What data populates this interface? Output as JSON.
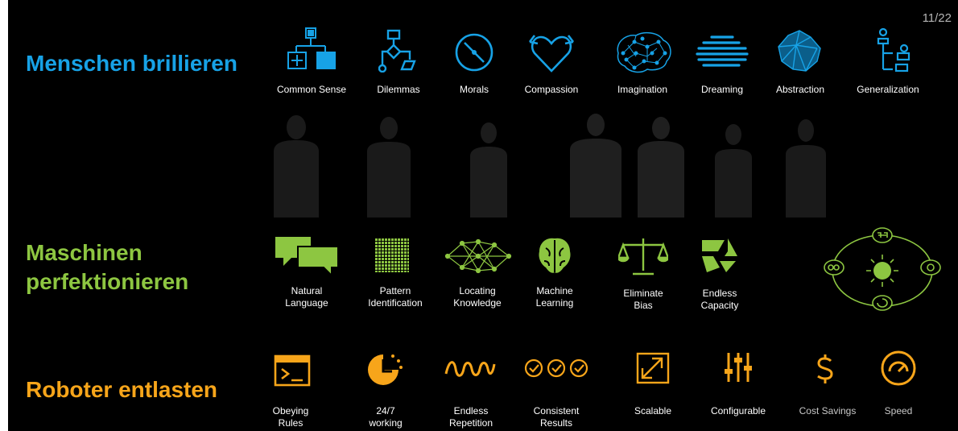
{
  "page_number": "11/22",
  "sections": {
    "humans": {
      "title": "Menschen brillieren",
      "color": "#17a2e6",
      "items": [
        {
          "label": "Common Sense",
          "icon": "decision-tree-icon"
        },
        {
          "label": "Dilemmas",
          "icon": "flowchart-icon"
        },
        {
          "label": "Morals",
          "icon": "compass-needle-icon"
        },
        {
          "label": "Compassion",
          "icon": "heart-arrows-icon"
        },
        {
          "label": "Imagination",
          "icon": "brain-network-icon"
        },
        {
          "label": "Dreaming",
          "icon": "cloud-lines-icon"
        },
        {
          "label": "Abstraction",
          "icon": "polygon-mesh-icon"
        },
        {
          "label": "Generalization",
          "icon": "hierarchy-nodes-icon"
        }
      ]
    },
    "machines": {
      "title_line1": "Maschinen",
      "title_line2": "perfektionieren",
      "color": "#8dc641",
      "items": [
        {
          "line1": "Natural",
          "line2": "Language",
          "icon": "speech-bubbles-icon"
        },
        {
          "line1": "Pattern",
          "line2": "Identification",
          "icon": "dot-grid-icon"
        },
        {
          "line1": "Locating",
          "line2": "Knowledge",
          "icon": "network-graph-icon"
        },
        {
          "line1": "Machine",
          "line2": "Learning",
          "icon": "brain-icon"
        },
        {
          "line1": "Eliminate",
          "line2": "Bias",
          "icon": "balance-scale-icon"
        },
        {
          "line1": "Endless",
          "line2": "Capacity",
          "icon": "aperture-icon"
        }
      ]
    },
    "robots": {
      "title": "Roboter entlasten",
      "color": "#f7a51a",
      "items": [
        {
          "line1": "Obeying",
          "line2": "Rules",
          "icon": "terminal-icon"
        },
        {
          "line1": "24/7",
          "line2": "working",
          "icon": "clock-icon"
        },
        {
          "line1": "Endless",
          "line2": "Repetition",
          "icon": "wave-icon"
        },
        {
          "line1": "Consistent",
          "line2": "Results",
          "icon": "check-circles-icon"
        },
        {
          "line1": "Scalable",
          "line2": "",
          "icon": "scale-arrows-icon"
        },
        {
          "line1": "Configurable",
          "line2": "",
          "icon": "sliders-icon"
        },
        {
          "line1": "Cost Savings",
          "line2": "",
          "icon": "dollar-icon"
        },
        {
          "line1": "Speed",
          "line2": "",
          "icon": "speedometer-icon"
        }
      ]
    }
  }
}
